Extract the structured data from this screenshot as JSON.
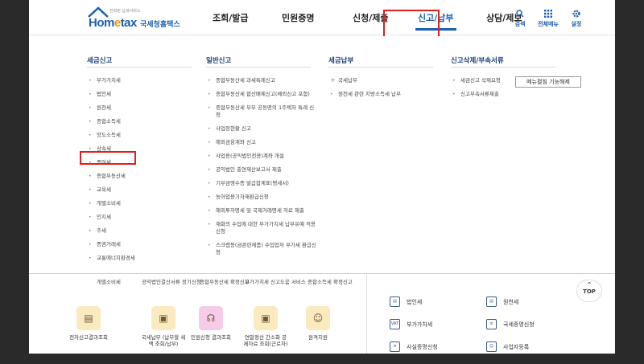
{
  "header": {
    "logo": {
      "brand_prefix": "Hom",
      "brand_e": "e",
      "brand_suffix": "tax",
      "korean": "국세청홈택스",
      "tagline": "진화된 납세서비스"
    },
    "nav": [
      {
        "label": "조회/발급"
      },
      {
        "label": "민원증명"
      },
      {
        "label": "신청/제출"
      },
      {
        "label": "신고/납부"
      },
      {
        "label": "상담/제보"
      }
    ],
    "tools": [
      {
        "label": "검색",
        "icon": "search-icon"
      },
      {
        "label": "전체메뉴",
        "icon": "grid-icon"
      },
      {
        "label": "설정",
        "icon": "gear-icon"
      }
    ],
    "menu_off_label": "메뉴펼침 기능해제"
  },
  "mega": {
    "columns": [
      {
        "title": "세금신고",
        "items": [
          "부가가치세",
          "법인세",
          "원천세",
          "종합소득세",
          "양도소득세",
          "상속세",
          "증여세",
          "종합부동산세",
          "교육세",
          "개별소비세",
          "인지세",
          "주세",
          "증권거래세",
          "교통에너지환경세"
        ]
      },
      {
        "title": "일반신고",
        "items": [
          "종합부동산세 과세특례신고",
          "종합부동산세 합산배제신고(체외신고 포함)",
          "종합부동산세 부부 공동명의 1주택자 특례 신청",
          "사업장현황 신고",
          "해외금융계좌 신고",
          "사업용(공익법인전용)계좌 개설",
          "공익법인 출연재산보고서 제출",
          "기부금영수증 발급합계표(명세서)",
          "농어업용기자재환급신청",
          "해외투자명세 및 국제거래명세 자료 제출",
          "재화의 수입에 대한 부가가치세 납부유예 적용 신청",
          "스크랩등(금관련제품) 수입업자 부가세 환급신청"
        ]
      },
      {
        "title": "세금납부",
        "items": [
          "국세납부",
          "원천세 관련 지방소득세 납부"
        ]
      },
      {
        "title": "신고삭제/부속서류",
        "items": [
          "세금신고 삭제요청",
          "신고부속서류제출"
        ]
      }
    ]
  },
  "bottom": {
    "cut_labels": [
      "개별소비세",
      "공익법인결산서류 정기신청",
      "종합부동산세 확정신고",
      "부가가치세 신고도움 서비스",
      "종합소득세 확정신고"
    ],
    "services": [
      {
        "label": "전자신고결과조회",
        "icon": "document-icon"
      },
      {
        "label": "국세납부 (납부할 세액 조회/납부)",
        "icon": "wallet-icon"
      },
      {
        "label": "민원신청 결과조회",
        "icon": "headset-icon"
      },
      {
        "label": "연말정산 간소화 공제자료 조회(근로자)",
        "icon": "wallet-icon"
      },
      {
        "label": "원격지원",
        "icon": "support-icon"
      }
    ],
    "right_list": [
      {
        "label": "법인세",
        "icon": "corporate-tax-icon"
      },
      {
        "label": "원천세",
        "icon": "withholding-tax-icon"
      },
      {
        "label": "부가가치세",
        "icon": "vat-icon"
      },
      {
        "label": "국세증명신청",
        "icon": "certificate-icon"
      },
      {
        "label": "사실증명신청",
        "icon": "fact-certificate-icon"
      },
      {
        "label": "사업자등록",
        "icon": "business-registration-icon"
      }
    ]
  },
  "top_button": {
    "label": "TOP"
  }
}
